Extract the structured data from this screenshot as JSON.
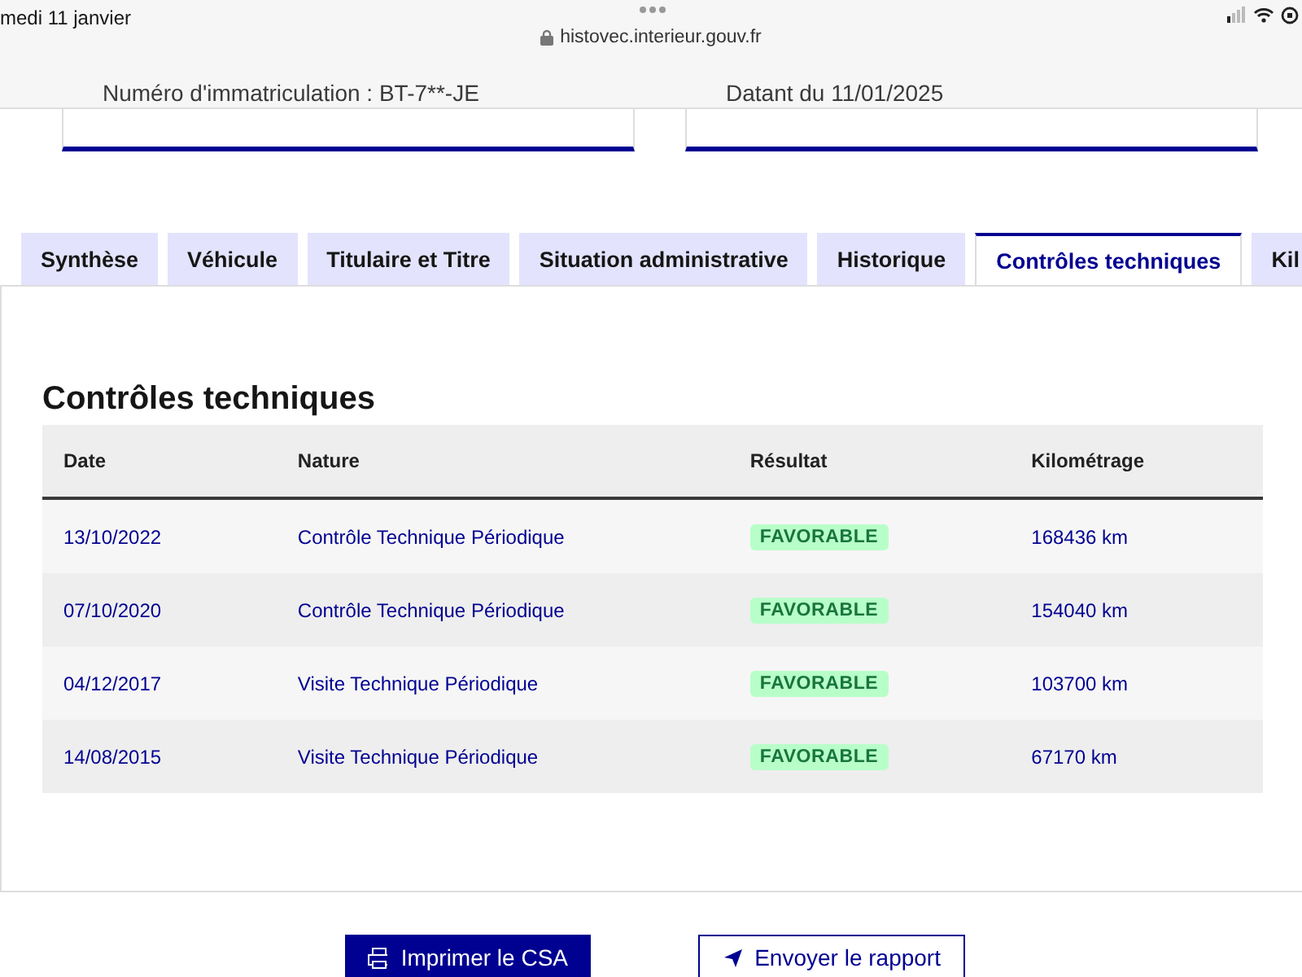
{
  "status_bar": {
    "date": "medi 11 janvier",
    "url": "histovec.interieur.gouv.fr"
  },
  "cards": [
    {
      "text": "Numéro d'immatriculation : BT-7**-JE"
    },
    {
      "text": "Datant du 11/01/2025"
    }
  ],
  "tabs": [
    {
      "label": "Synthèse",
      "selected": false
    },
    {
      "label": "Véhicule",
      "selected": false
    },
    {
      "label": "Titulaire et Titre",
      "selected": false
    },
    {
      "label": "Situation administrative",
      "selected": false
    },
    {
      "label": "Historique",
      "selected": false
    },
    {
      "label": "Contrôles techniques",
      "selected": true
    },
    {
      "label": "Kil",
      "selected": false
    }
  ],
  "section": {
    "title": "Contrôles techniques",
    "table": {
      "columns": [
        "Date",
        "Nature",
        "Résultat",
        "Kilométrage"
      ],
      "rows": [
        {
          "date": "13/10/2022",
          "nature": "Contrôle Technique Périodique",
          "result": "FAVORABLE",
          "mileage": "168436 km"
        },
        {
          "date": "07/10/2020",
          "nature": "Contrôle Technique Périodique",
          "result": "FAVORABLE",
          "mileage": "154040 km"
        },
        {
          "date": "04/12/2017",
          "nature": "Visite Technique Périodique",
          "result": "FAVORABLE",
          "mileage": "103700 km"
        },
        {
          "date": "14/08/2015",
          "nature": "Visite Technique Périodique",
          "result": "FAVORABLE",
          "mileage": "67170 km"
        }
      ]
    }
  },
  "buttons": [
    {
      "label": "Imprimer le CSA",
      "kind": "primary"
    },
    {
      "label": "Envoyer le rapport",
      "kind": "secondary"
    }
  ]
}
